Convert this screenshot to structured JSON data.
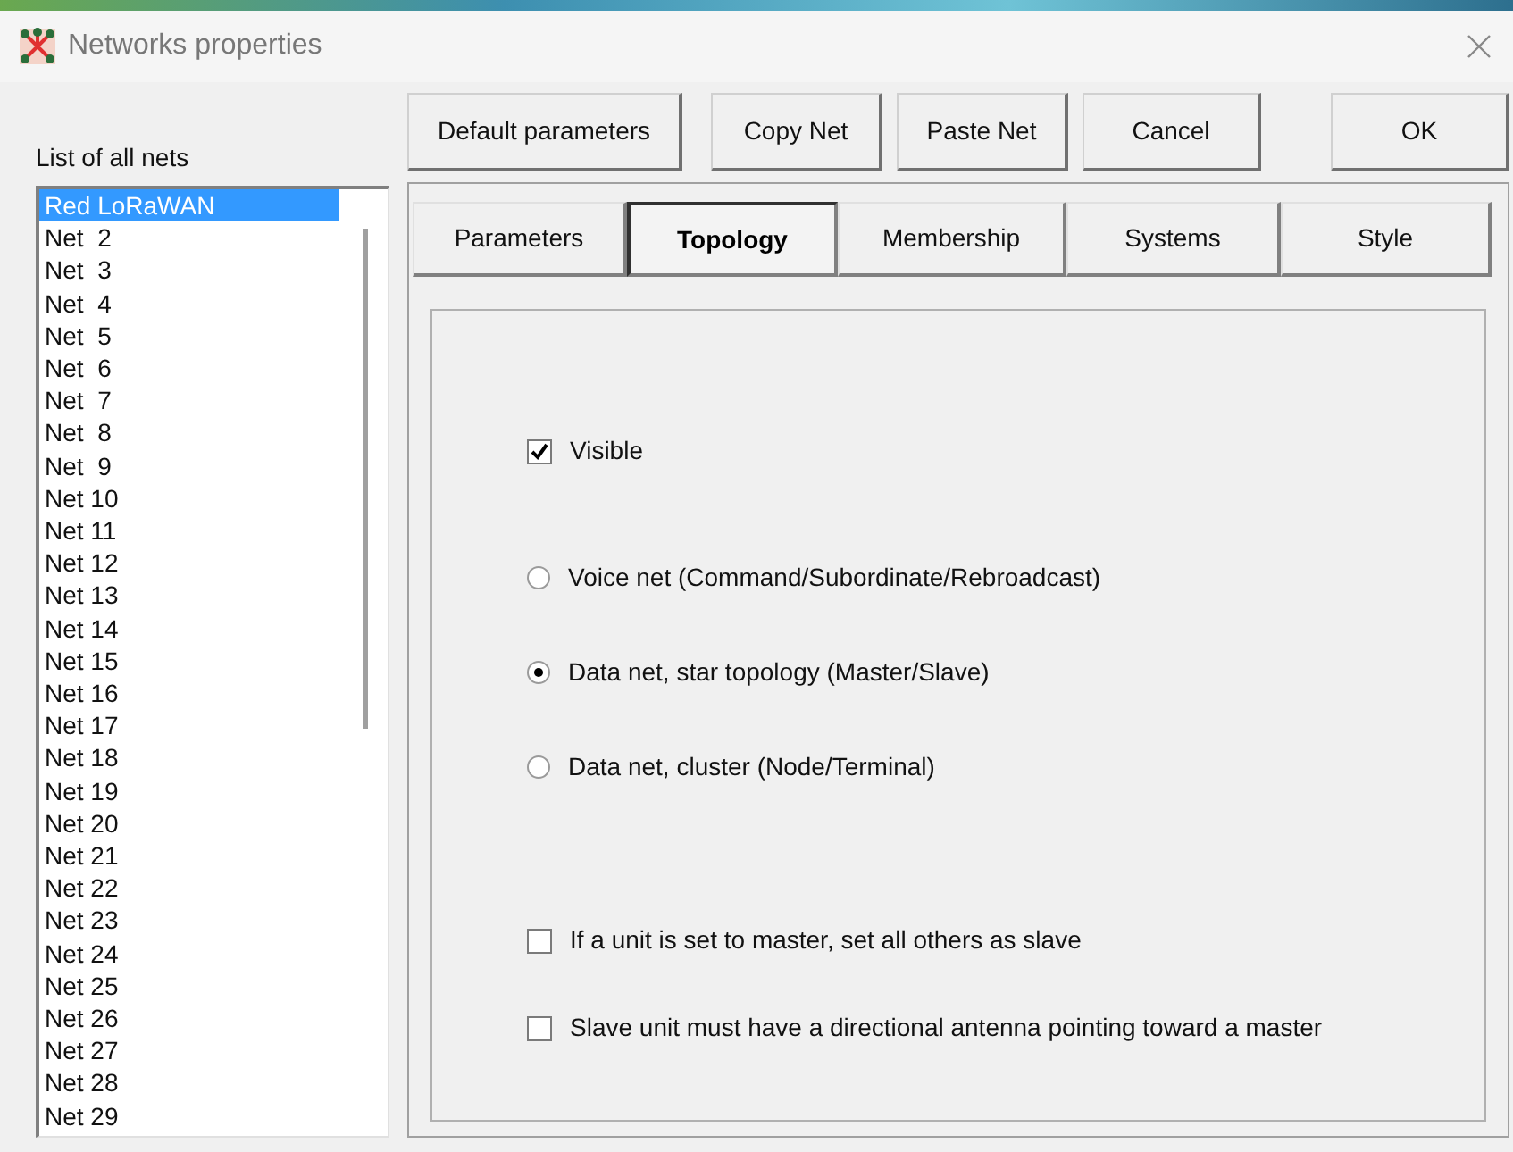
{
  "window": {
    "title": "Networks properties"
  },
  "net_list": {
    "label": "List of all nets",
    "items": [
      {
        "label": "Red LoRaWAN",
        "selected": true
      },
      {
        "label": "Net  2",
        "selected": false
      },
      {
        "label": "Net  3",
        "selected": false
      },
      {
        "label": "Net  4",
        "selected": false
      },
      {
        "label": "Net  5",
        "selected": false
      },
      {
        "label": "Net  6",
        "selected": false
      },
      {
        "label": "Net  7",
        "selected": false
      },
      {
        "label": "Net  8",
        "selected": false
      },
      {
        "label": "Net  9",
        "selected": false
      },
      {
        "label": "Net 10",
        "selected": false
      },
      {
        "label": "Net 11",
        "selected": false
      },
      {
        "label": "Net 12",
        "selected": false
      },
      {
        "label": "Net 13",
        "selected": false
      },
      {
        "label": "Net 14",
        "selected": false
      },
      {
        "label": "Net 15",
        "selected": false
      },
      {
        "label": "Net 16",
        "selected": false
      },
      {
        "label": "Net 17",
        "selected": false
      },
      {
        "label": "Net 18",
        "selected": false
      },
      {
        "label": "Net 19",
        "selected": false
      },
      {
        "label": "Net 20",
        "selected": false
      },
      {
        "label": "Net 21",
        "selected": false
      },
      {
        "label": "Net 22",
        "selected": false
      },
      {
        "label": "Net 23",
        "selected": false
      },
      {
        "label": "Net 24",
        "selected": false
      },
      {
        "label": "Net 25",
        "selected": false
      },
      {
        "label": "Net 26",
        "selected": false
      },
      {
        "label": "Net 27",
        "selected": false
      },
      {
        "label": "Net 28",
        "selected": false
      },
      {
        "label": "Net 29",
        "selected": false
      }
    ]
  },
  "buttons": [
    "Default parameters",
    "Copy Net",
    "Paste Net",
    "Cancel",
    "OK"
  ],
  "tabs": [
    {
      "label": "Parameters",
      "selected": false
    },
    {
      "label": "Topology",
      "selected": true
    },
    {
      "label": "Membership",
      "selected": false
    },
    {
      "label": "Systems",
      "selected": false
    },
    {
      "label": "Style",
      "selected": false
    }
  ],
  "topology": {
    "sections": [
      {
        "items": [
          {
            "kind": "checkbox",
            "label": "Visible",
            "checked": true
          }
        ]
      },
      {
        "items": [
          {
            "kind": "radio",
            "label": "Voice net (Command/Subordinate/Rebroadcast)",
            "selected": false
          },
          {
            "kind": "radio",
            "label": "Data net, star topology (Master/Slave)",
            "selected": true
          },
          {
            "kind": "radio",
            "label": "Data net, cluster (Node/Terminal)",
            "selected": false
          }
        ]
      },
      {
        "items": [
          {
            "kind": "checkbox",
            "label": "If a unit is set to master, set all others as slave",
            "checked": false
          },
          {
            "kind": "checkbox",
            "label": "Slave unit must have a directional antenna pointing toward a master",
            "checked": false
          }
        ]
      }
    ]
  }
}
